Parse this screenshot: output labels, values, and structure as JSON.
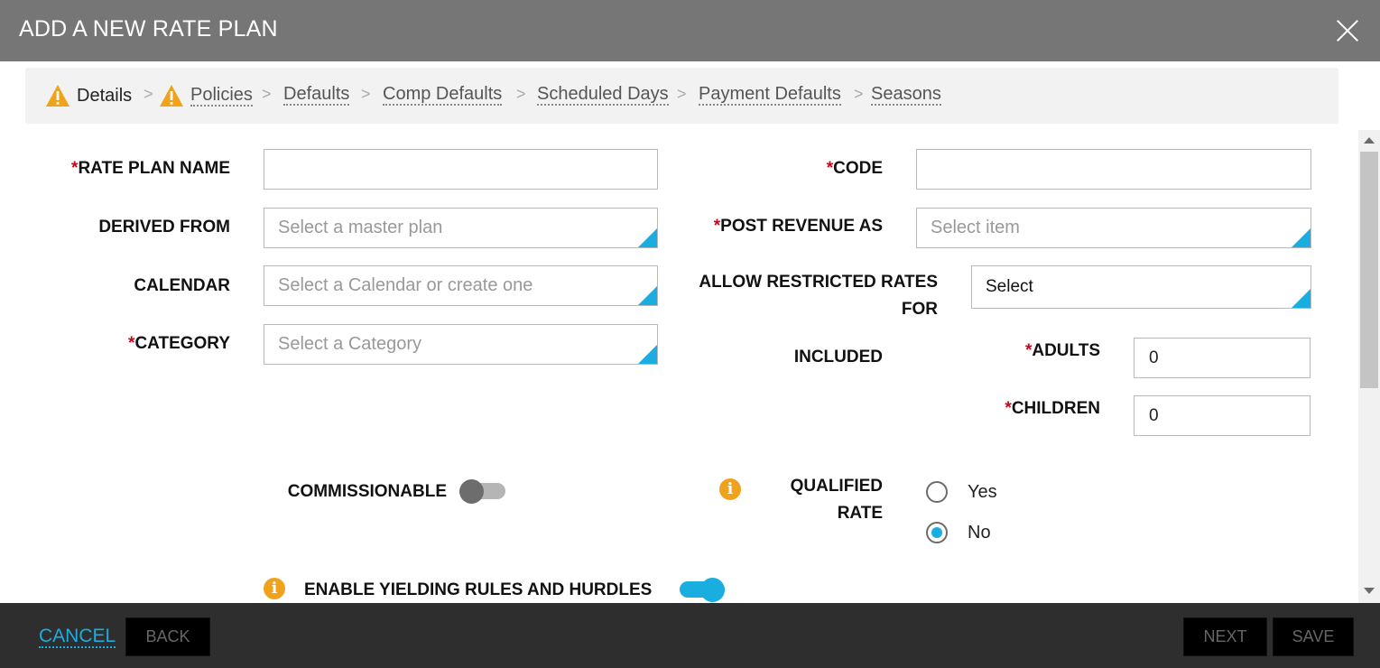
{
  "header": {
    "title": "ADD A NEW RATE PLAN",
    "close_icon": "close-icon"
  },
  "breadcrumb": {
    "separator": ">",
    "items": [
      {
        "label": "Details",
        "warning": true,
        "active": true
      },
      {
        "label": "Policies",
        "warning": true,
        "active": false
      },
      {
        "label": "Defaults",
        "warning": false,
        "active": false
      },
      {
        "label": "Comp Defaults",
        "warning": false,
        "active": false
      },
      {
        "label": "Scheduled Days",
        "warning": false,
        "active": false
      },
      {
        "label": "Payment Defaults",
        "warning": false,
        "active": false
      },
      {
        "label": "Seasons",
        "warning": false,
        "active": false
      }
    ]
  },
  "form": {
    "required_marker": "*",
    "rate_plan_name": {
      "label": "RATE PLAN NAME",
      "value": ""
    },
    "code": {
      "label": "CODE",
      "value": ""
    },
    "derived_from": {
      "label": "DERIVED FROM",
      "placeholder": "Select a master plan"
    },
    "post_revenue_as": {
      "label": "POST REVENUE AS",
      "placeholder": "Select item"
    },
    "calendar": {
      "label": "CALENDAR",
      "placeholder": "Select a Calendar or create one"
    },
    "allow_restricted": {
      "label_line1": "ALLOW RESTRICTED RATES",
      "label_line2": "FOR",
      "value": "Select"
    },
    "category": {
      "label": "CATEGORY",
      "placeholder": "Select a Category"
    },
    "included": {
      "label": "INCLUDED"
    },
    "adults": {
      "label": "ADULTS",
      "value": "0"
    },
    "children": {
      "label": "CHILDREN",
      "value": "0"
    },
    "commissionable": {
      "label": "COMMISSIONABLE",
      "on": false
    },
    "qualified_rate": {
      "label_line1": "QUALIFIED",
      "label_line2": "RATE",
      "options": [
        {
          "label": "Yes",
          "selected": false
        },
        {
          "label": "No",
          "selected": true
        }
      ]
    },
    "yielding": {
      "label": "ENABLE YIELDING RULES AND HURDLES",
      "on": true
    },
    "info_glyph": "i"
  },
  "footer": {
    "cancel": "CANCEL",
    "back": "BACK",
    "next": "NEXT",
    "save": "SAVE"
  },
  "colors": {
    "accent": "#1aaee0",
    "warning": "#f0a21b",
    "required": "#d0021b",
    "header_bg": "#767676",
    "footer_bg": "#2e2e2e"
  }
}
